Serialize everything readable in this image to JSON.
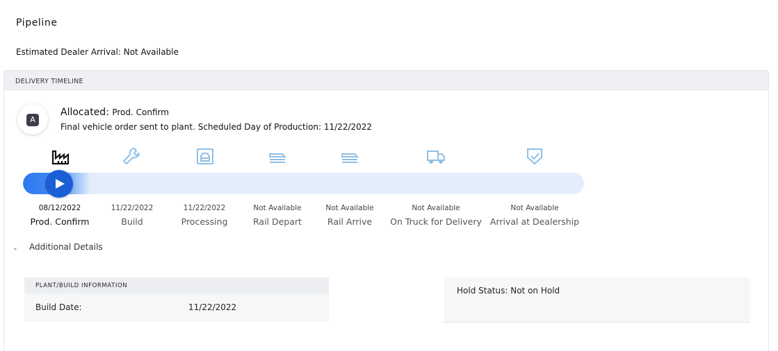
{
  "page": {
    "title": "Pipeline",
    "dealer_arrival": "Estimated Dealer Arrival: Not Available"
  },
  "timeline": {
    "header": "DELIVERY TIMELINE",
    "status_badge_letter": "A",
    "status_label": "Allocated:",
    "status_value": "Prod. Confirm",
    "description": "Final vehicle order sent to plant. Scheduled Day of Production: 11/22/2022",
    "progress_fraction": 0.12,
    "stages": [
      {
        "icon": "factory-icon",
        "date": "08/12/2022",
        "name": "Prod. Confirm"
      },
      {
        "icon": "wrench-icon",
        "date": "11/22/2022",
        "name": "Build"
      },
      {
        "icon": "processing-icon",
        "date": "11/22/2022",
        "name": "Processing"
      },
      {
        "icon": "rail-depart-icon",
        "date": "Not Available",
        "name": "Rail Depart"
      },
      {
        "icon": "rail-arrive-icon",
        "date": "Not Available",
        "name": "Rail Arrive"
      },
      {
        "icon": "truck-icon",
        "date": "Not Available",
        "name": "On Truck for Delivery"
      },
      {
        "icon": "shield-check-icon",
        "date": "Not Available",
        "name": "Arrival at Dealership"
      }
    ]
  },
  "details": {
    "toggle_label": "Additional Details",
    "plant": {
      "header": "PLANT/BUILD INFORMATION",
      "build_date_label": "Build Date:",
      "build_date_value": "11/22/2022"
    },
    "hold_status": "Hold Status: Not on Hold"
  },
  "colors": {
    "accent": "#1b5fd6",
    "track": "#e2eefc",
    "icon_inactive": "#8fc0e6",
    "icon_active": "#111111"
  }
}
